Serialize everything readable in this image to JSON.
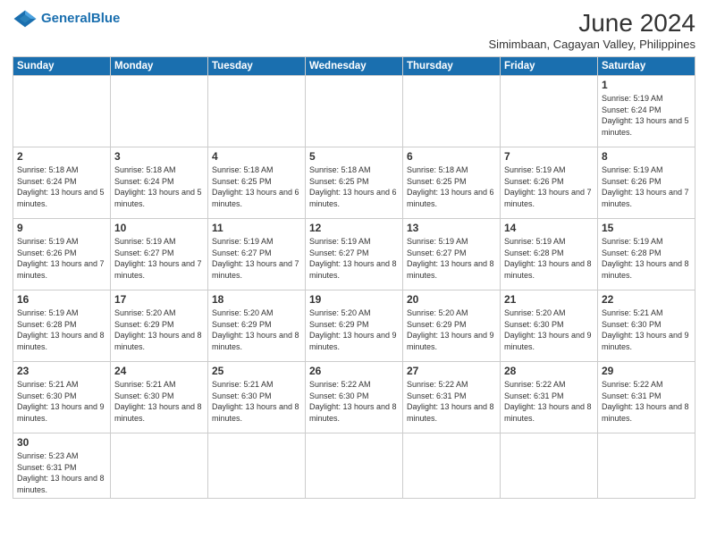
{
  "header": {
    "logo_general": "General",
    "logo_blue": "Blue",
    "title": "June 2024",
    "subtitle": "Simimbaan, Cagayan Valley, Philippines"
  },
  "weekdays": [
    "Sunday",
    "Monday",
    "Tuesday",
    "Wednesday",
    "Thursday",
    "Friday",
    "Saturday"
  ],
  "weeks": [
    [
      {
        "day": "",
        "info": ""
      },
      {
        "day": "",
        "info": ""
      },
      {
        "day": "",
        "info": ""
      },
      {
        "day": "",
        "info": ""
      },
      {
        "day": "",
        "info": ""
      },
      {
        "day": "",
        "info": ""
      },
      {
        "day": "1",
        "info": "Sunrise: 5:19 AM\nSunset: 6:24 PM\nDaylight: 13 hours and 5 minutes."
      }
    ],
    [
      {
        "day": "2",
        "info": "Sunrise: 5:18 AM\nSunset: 6:24 PM\nDaylight: 13 hours and 5 minutes."
      },
      {
        "day": "3",
        "info": "Sunrise: 5:18 AM\nSunset: 6:24 PM\nDaylight: 13 hours and 5 minutes."
      },
      {
        "day": "4",
        "info": "Sunrise: 5:18 AM\nSunset: 6:25 PM\nDaylight: 13 hours and 6 minutes."
      },
      {
        "day": "5",
        "info": "Sunrise: 5:18 AM\nSunset: 6:25 PM\nDaylight: 13 hours and 6 minutes."
      },
      {
        "day": "6",
        "info": "Sunrise: 5:18 AM\nSunset: 6:25 PM\nDaylight: 13 hours and 6 minutes."
      },
      {
        "day": "7",
        "info": "Sunrise: 5:19 AM\nSunset: 6:26 PM\nDaylight: 13 hours and 7 minutes."
      },
      {
        "day": "8",
        "info": "Sunrise: 5:19 AM\nSunset: 6:26 PM\nDaylight: 13 hours and 7 minutes."
      }
    ],
    [
      {
        "day": "9",
        "info": "Sunrise: 5:19 AM\nSunset: 6:26 PM\nDaylight: 13 hours and 7 minutes."
      },
      {
        "day": "10",
        "info": "Sunrise: 5:19 AM\nSunset: 6:27 PM\nDaylight: 13 hours and 7 minutes."
      },
      {
        "day": "11",
        "info": "Sunrise: 5:19 AM\nSunset: 6:27 PM\nDaylight: 13 hours and 7 minutes."
      },
      {
        "day": "12",
        "info": "Sunrise: 5:19 AM\nSunset: 6:27 PM\nDaylight: 13 hours and 8 minutes."
      },
      {
        "day": "13",
        "info": "Sunrise: 5:19 AM\nSunset: 6:27 PM\nDaylight: 13 hours and 8 minutes."
      },
      {
        "day": "14",
        "info": "Sunrise: 5:19 AM\nSunset: 6:28 PM\nDaylight: 13 hours and 8 minutes."
      },
      {
        "day": "15",
        "info": "Sunrise: 5:19 AM\nSunset: 6:28 PM\nDaylight: 13 hours and 8 minutes."
      }
    ],
    [
      {
        "day": "16",
        "info": "Sunrise: 5:19 AM\nSunset: 6:28 PM\nDaylight: 13 hours and 8 minutes."
      },
      {
        "day": "17",
        "info": "Sunrise: 5:20 AM\nSunset: 6:29 PM\nDaylight: 13 hours and 8 minutes."
      },
      {
        "day": "18",
        "info": "Sunrise: 5:20 AM\nSunset: 6:29 PM\nDaylight: 13 hours and 8 minutes."
      },
      {
        "day": "19",
        "info": "Sunrise: 5:20 AM\nSunset: 6:29 PM\nDaylight: 13 hours and 9 minutes."
      },
      {
        "day": "20",
        "info": "Sunrise: 5:20 AM\nSunset: 6:29 PM\nDaylight: 13 hours and 9 minutes."
      },
      {
        "day": "21",
        "info": "Sunrise: 5:20 AM\nSunset: 6:30 PM\nDaylight: 13 hours and 9 minutes."
      },
      {
        "day": "22",
        "info": "Sunrise: 5:21 AM\nSunset: 6:30 PM\nDaylight: 13 hours and 9 minutes."
      }
    ],
    [
      {
        "day": "23",
        "info": "Sunrise: 5:21 AM\nSunset: 6:30 PM\nDaylight: 13 hours and 9 minutes."
      },
      {
        "day": "24",
        "info": "Sunrise: 5:21 AM\nSunset: 6:30 PM\nDaylight: 13 hours and 8 minutes."
      },
      {
        "day": "25",
        "info": "Sunrise: 5:21 AM\nSunset: 6:30 PM\nDaylight: 13 hours and 8 minutes."
      },
      {
        "day": "26",
        "info": "Sunrise: 5:22 AM\nSunset: 6:30 PM\nDaylight: 13 hours and 8 minutes."
      },
      {
        "day": "27",
        "info": "Sunrise: 5:22 AM\nSunset: 6:31 PM\nDaylight: 13 hours and 8 minutes."
      },
      {
        "day": "28",
        "info": "Sunrise: 5:22 AM\nSunset: 6:31 PM\nDaylight: 13 hours and 8 minutes."
      },
      {
        "day": "29",
        "info": "Sunrise: 5:22 AM\nSunset: 6:31 PM\nDaylight: 13 hours and 8 minutes."
      }
    ],
    [
      {
        "day": "30",
        "info": "Sunrise: 5:23 AM\nSunset: 6:31 PM\nDaylight: 13 hours and 8 minutes."
      },
      {
        "day": "",
        "info": ""
      },
      {
        "day": "",
        "info": ""
      },
      {
        "day": "",
        "info": ""
      },
      {
        "day": "",
        "info": ""
      },
      {
        "day": "",
        "info": ""
      },
      {
        "day": "",
        "info": ""
      }
    ]
  ]
}
